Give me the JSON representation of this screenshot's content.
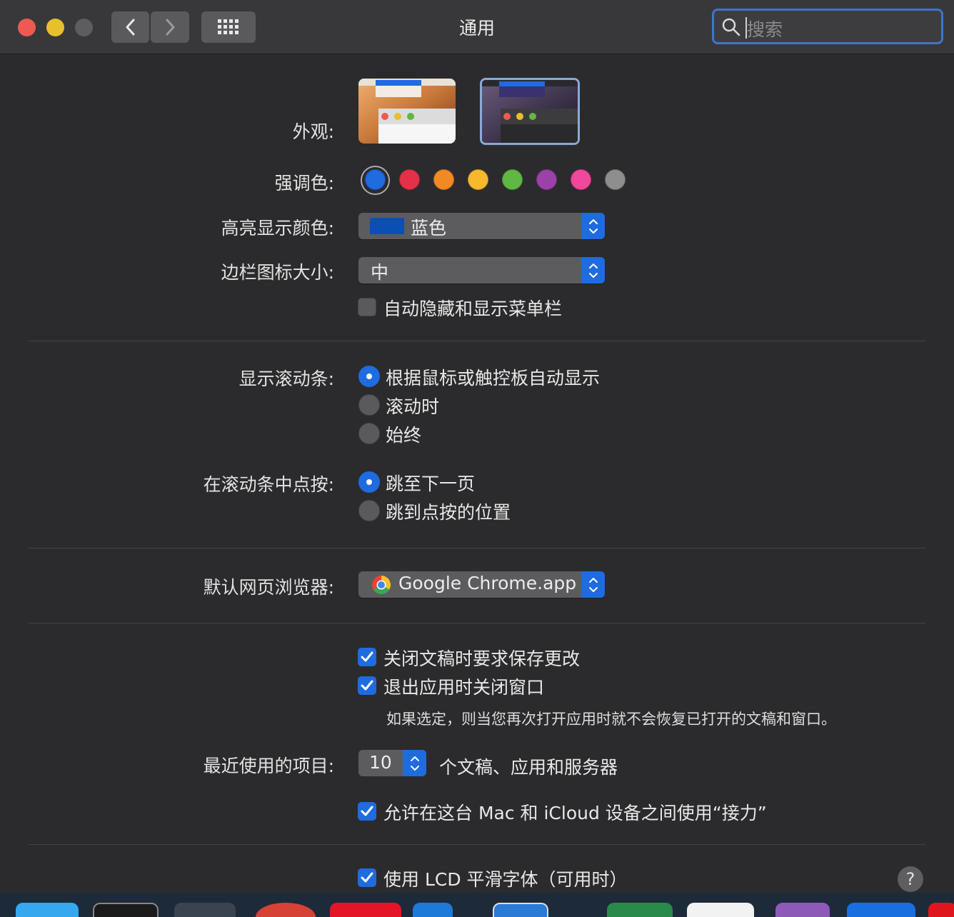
{
  "window": {
    "title": "通用",
    "search_placeholder": "搜索",
    "traffic_lights": {
      "close": "#ee5a52",
      "minimize": "#e7c02e",
      "zoom": "#5d5d5f"
    }
  },
  "appearance": {
    "label": "外观:",
    "options": [
      {
        "name": "light"
      },
      {
        "name": "dark",
        "selected": true
      }
    ]
  },
  "accent": {
    "label": "强调色:",
    "colors": [
      "#1f6be0",
      "#e5304a",
      "#f28a24",
      "#f7b92b",
      "#5fb843",
      "#9b42a8",
      "#f2479a",
      "#8e8e8e"
    ],
    "selected_index": 0
  },
  "highlight": {
    "label": "高亮显示颜色:",
    "value": "蓝色",
    "swatch": "#0b4fb4"
  },
  "sidebar_icon": {
    "label": "边栏图标大小:",
    "value": "中"
  },
  "menubar_autohide": {
    "label": "自动隐藏和显示菜单栏",
    "checked": false
  },
  "show_scrollbars": {
    "label": "显示滚动条:",
    "options": [
      "根据鼠标或触控板自动显示",
      "滚动时",
      "始终"
    ],
    "selected_index": 0
  },
  "click_scrollbar": {
    "label": "在滚动条中点按:",
    "options": [
      "跳至下一页",
      "跳到点按的位置"
    ],
    "selected_index": 0
  },
  "browser": {
    "label": "默认网页浏览器:",
    "value": "Google Chrome.app"
  },
  "ask_save": {
    "label": "关闭文稿时要求保存更改",
    "checked": true
  },
  "close_windows": {
    "label": "退出应用时关闭窗口",
    "checked": true
  },
  "close_windows_note": "如果选定，则当您再次打开应用时就不会恢复已打开的文稿和窗口。",
  "recent_items": {
    "label": "最近使用的项目:",
    "value": "10",
    "suffix": "个文稿、应用和服务器"
  },
  "handoff": {
    "label": "允许在这台 Mac 和 iCloud 设备之间使用“接力”",
    "checked": true
  },
  "lcd_smoothing": {
    "label": "使用 LCD 平滑字体（可用时）",
    "checked": true
  },
  "help_label": "?"
}
